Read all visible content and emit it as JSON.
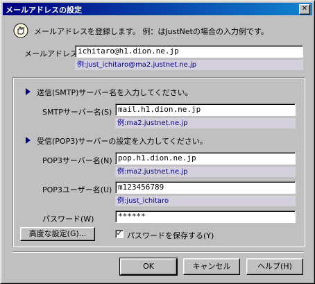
{
  "window": {
    "title": "メールアドレスの設定"
  },
  "intro": "メールアドレスを登録します。 例：はJustNetの場合の入力例です。",
  "email": {
    "label": "メールアドレス(A)",
    "value": "ichitaro@h1.dion.ne.jp",
    "example": "例:just_ichitaro@ma2.justnet.ne.jp"
  },
  "smtp": {
    "heading": "送信(SMTP)サーバー名を入力してください。",
    "label": "SMTPサーバー名(S)",
    "value": "mail.h1.dion.ne.jp",
    "example": "例:ma2.justnet.ne.jp"
  },
  "pop3": {
    "heading": "受信(POP3)サーバーの設定を入力してください。",
    "server_label": "POP3サーバー名(N)",
    "server_value": "pop.h1.dion.ne.jp",
    "server_example": "例:ma2.justnet.ne.jp",
    "user_label": "POP3ユーザー名(U)",
    "user_value": "m123456789",
    "user_example": "例:just_ichitaro",
    "password_label": "パスワード(W)",
    "password_value": "******"
  },
  "advanced_button": "高度な設定(G)...",
  "save_password": {
    "label": "パスワードを保存する(Y)",
    "checked": true,
    "mark": "✓"
  },
  "buttons": {
    "ok": "OK",
    "cancel": "キャンセル",
    "help": "ヘルプ(H)"
  },
  "colors": {
    "titlebar": "#000080",
    "example_bg": "#d4d0dc",
    "example_text": "#00008b"
  }
}
